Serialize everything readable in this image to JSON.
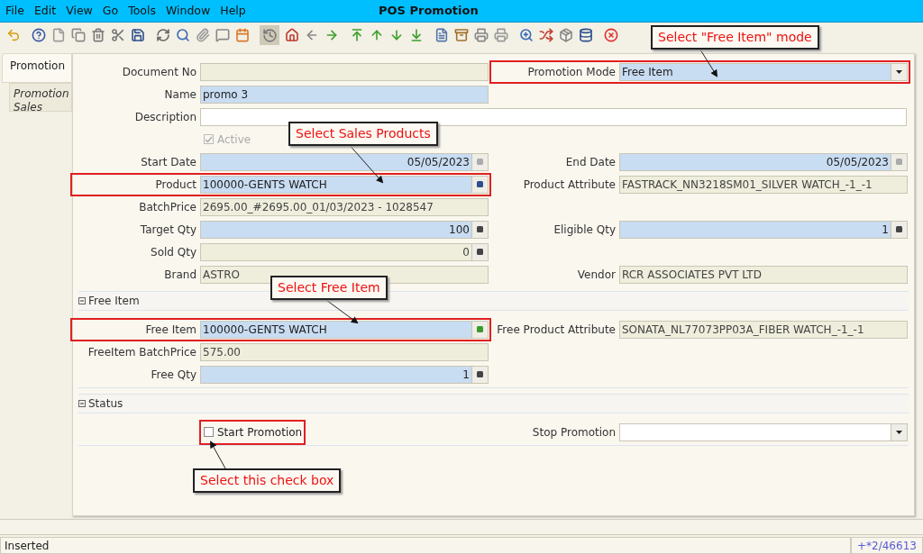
{
  "menu_bar": {
    "items": [
      "File",
      "Edit",
      "View",
      "Go",
      "Tools",
      "Window",
      "Help"
    ],
    "title": "POS Promotion"
  },
  "tabs": [
    {
      "label": "Promotion",
      "selected": true
    },
    {
      "label": "Promotion Sales",
      "selected": false
    }
  ],
  "form": {
    "rows": [
      {
        "left": {
          "kind": "text",
          "label": "Document No",
          "readonly": true,
          "highlighted": false
        },
        "right": {
          "kind": "combo",
          "label": "Promotion Mode",
          "value": "Free Item",
          "mandatory": true,
          "readonly": false,
          "highlighted": true
        }
      },
      {
        "left": {
          "kind": "text",
          "label": "Name",
          "value": "promo 3",
          "mandatory": true,
          "readonly": false,
          "highlighted": false
        }
      },
      {
        "wide": {
          "kind": "text",
          "label": "Description",
          "mandatory": false,
          "readonly": false,
          "highlighted": false
        }
      },
      {
        "left": {
          "kind": "checkbox",
          "label": "Active",
          "checked": true,
          "disabled": true,
          "highlighted": false
        }
      },
      {
        "left": {
          "kind": "date",
          "label": "Start Date",
          "value": "05/05/2023",
          "mandatory": true,
          "readonly": false,
          "highlighted": false
        },
        "right": {
          "kind": "date",
          "label": "End Date",
          "value": "05/05/2023",
          "mandatory": true,
          "readonly": false,
          "highlighted": false
        }
      },
      {
        "left": {
          "kind": "lookup",
          "label": "Product",
          "value": "100000-GENTS WATCH",
          "mandatory": true,
          "readonly": false,
          "highlighted": true
        },
        "right": {
          "kind": "text",
          "label": "Product Attribute",
          "value": "FASTRACK_NN3218SM01_SILVER WATCH_-1_-1",
          "readonly": true,
          "highlighted": false
        }
      },
      {
        "left": {
          "kind": "text",
          "label": "BatchPrice",
          "value": "2695.00_#2695.00_01/03/2023 - 1028547",
          "readonly": true,
          "highlighted": false
        }
      },
      {
        "left": {
          "kind": "number",
          "label": "Target Qty",
          "value": "100",
          "mandatory": true,
          "readonly": false,
          "highlighted": false
        },
        "right": {
          "kind": "number",
          "label": "Eligible Qty",
          "value": "1",
          "mandatory": true,
          "readonly": false,
          "highlighted": false
        }
      },
      {
        "left": {
          "kind": "number",
          "label": "Sold Qty",
          "value": "0",
          "readonly": true,
          "highlighted": false
        }
      },
      {
        "left": {
          "kind": "text",
          "label": "Brand",
          "value": "ASTRO",
          "readonly": true,
          "highlighted": false
        },
        "right": {
          "kind": "text",
          "label": "Vendor",
          "value": "RCR ASSOCIATES PVT LTD",
          "readonly": true,
          "highlighted": false
        }
      }
    ]
  },
  "sections": [
    {
      "title": "Free Item",
      "expanded": true,
      "rows": [
        {
          "left": {
            "kind": "lookup",
            "label": "Free Item",
            "value": "100000-GENTS WATCH",
            "mandatory": true,
            "readonly": false,
            "highlighted": true
          },
          "right": {
            "kind": "text",
            "label": "Free Product Attribute",
            "value": "SONATA_NL77073PP03A_FIBER WATCH_-1_-1",
            "readonly": true,
            "highlighted": false
          }
        },
        {
          "left": {
            "kind": "text",
            "label": "FreeItem BatchPrice",
            "value": "575.00",
            "readonly": true,
            "highlighted": false
          }
        },
        {
          "left": {
            "kind": "number",
            "label": "Free Qty",
            "value": "1",
            "mandatory": true,
            "readonly": false,
            "highlighted": false
          }
        }
      ]
    },
    {
      "title": "Status",
      "expanded": true,
      "rows": [
        {
          "left": {
            "kind": "checkbox",
            "label": "Start Promotion",
            "checked": false,
            "disabled": false,
            "highlighted": true
          },
          "right": {
            "kind": "combo",
            "label": "Stop Promotion",
            "mandatory": false,
            "readonly": false,
            "highlighted": false
          }
        }
      ]
    }
  ],
  "annotations": [
    {
      "text": "Select \"Free Item\" mode"
    },
    {
      "text": "Select Sales Products"
    },
    {
      "text": "Select Free Item"
    },
    {
      "text": "Select this check box"
    }
  ],
  "status_bar": {
    "message": "Inserted",
    "record": "+*2/46613"
  }
}
